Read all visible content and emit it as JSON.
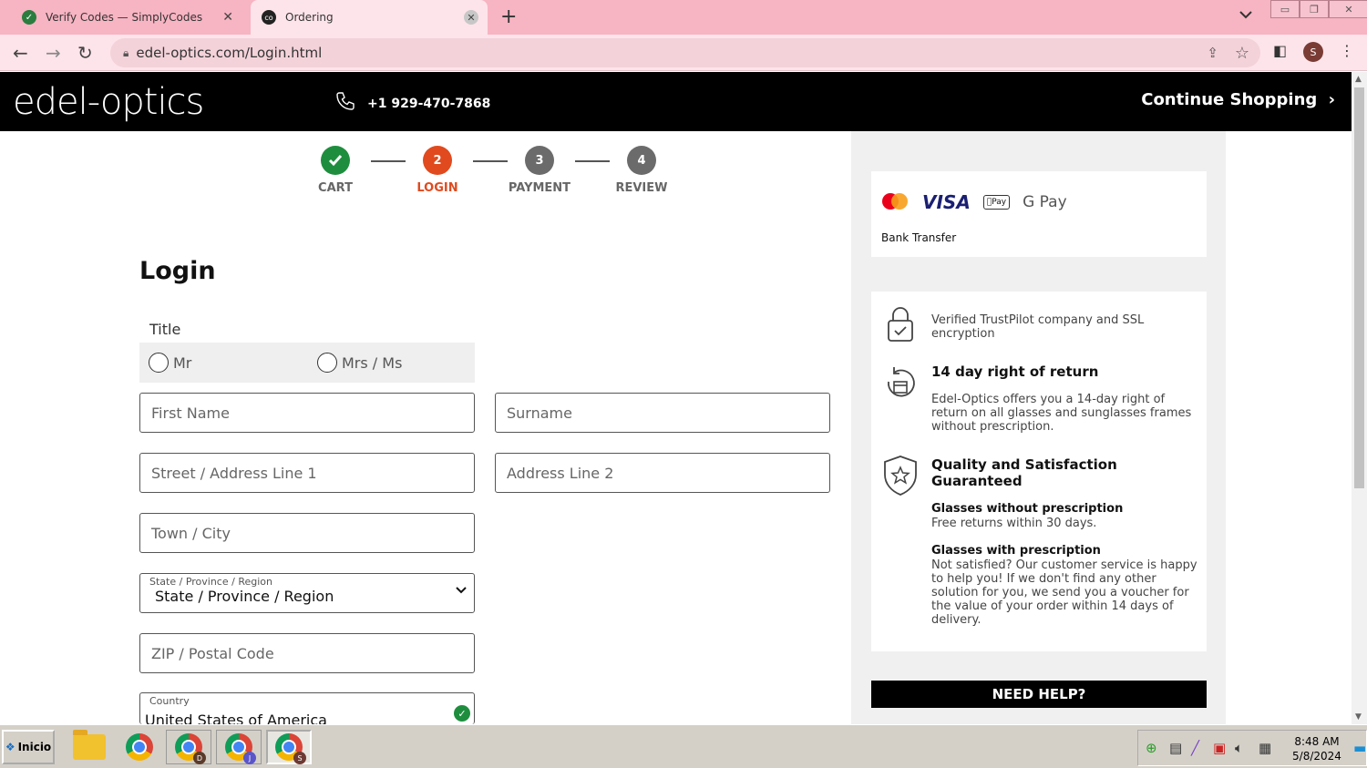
{
  "browser": {
    "tabs": [
      {
        "title": "Verify Codes — SimplyCodes",
        "icon": "simplycodes-icon"
      },
      {
        "title": "Ordering",
        "icon": "edel-optics-icon"
      }
    ],
    "url": "edel-optics.com/Login.html",
    "profile_initial": "S",
    "colors": {
      "tabbar": "#f7b4c2",
      "toolbar": "#fde4ea"
    }
  },
  "header": {
    "logo": "edel-optics",
    "phone": "+1 929-470-7868",
    "continue_label": "Continue Shopping"
  },
  "steps": [
    {
      "num": "✓",
      "label": "CART",
      "color": "#1e8e3e"
    },
    {
      "num": "2",
      "label": "LOGIN",
      "color": "#e04a1e"
    },
    {
      "num": "3",
      "label": "PAYMENT",
      "color": "#6b6b6b"
    },
    {
      "num": "4",
      "label": "REVIEW",
      "color": "#6b6b6b"
    }
  ],
  "form": {
    "heading": "Login",
    "title_label": "Title",
    "radio_mr": "Mr",
    "radio_mrs": "Mrs / Ms",
    "first_name_placeholder": "First Name",
    "surname_placeholder": "Surname",
    "street_placeholder": "Street / Address Line 1",
    "address2_placeholder": "Address Line 2",
    "city_placeholder": "Town / City",
    "state_label": "State / Province / Region",
    "state_value": "State / Province / Region",
    "zip_placeholder": "ZIP / Postal Code",
    "country_label": "Country",
    "country_value": "United States of America"
  },
  "sidebar": {
    "payment_methods": [
      "Mastercard",
      "VISA",
      "Apple Pay",
      "G Pay"
    ],
    "visa_label": "VISA",
    "apple_pay_label": "Pay",
    "gpay_label": "G Pay",
    "bank_transfer": "Bank Transfer",
    "trust_ssl": "Verified TrustPilot company and SSL encryption",
    "return_heading": "14 day right of return",
    "return_text": "Edel-Optics offers you a 14-day right of return on all glasses and sunglasses frames without prescription.",
    "quality_heading": "Quality and Satisfaction Guaranteed",
    "no_rx_heading": "Glasses without prescription",
    "no_rx_text": "Free returns within 30 days.",
    "rx_heading": "Glasses with prescription",
    "rx_text": "Not satisfied? Our customer service is happy to help you! If we don't find any other solution for you, we send you a voucher for the value of your order within 14 days of delivery.",
    "help_label": "NEED HELP?"
  },
  "taskbar": {
    "start_label": "Inicio",
    "time": "8:48 AM",
    "date": "5/8/2024",
    "chrome_badges": [
      {
        "letter": "D",
        "color": "#5b3b2a"
      },
      {
        "letter": "J",
        "color": "#5a55c8"
      },
      {
        "letter": "S",
        "color": "#6d3a33"
      }
    ]
  }
}
